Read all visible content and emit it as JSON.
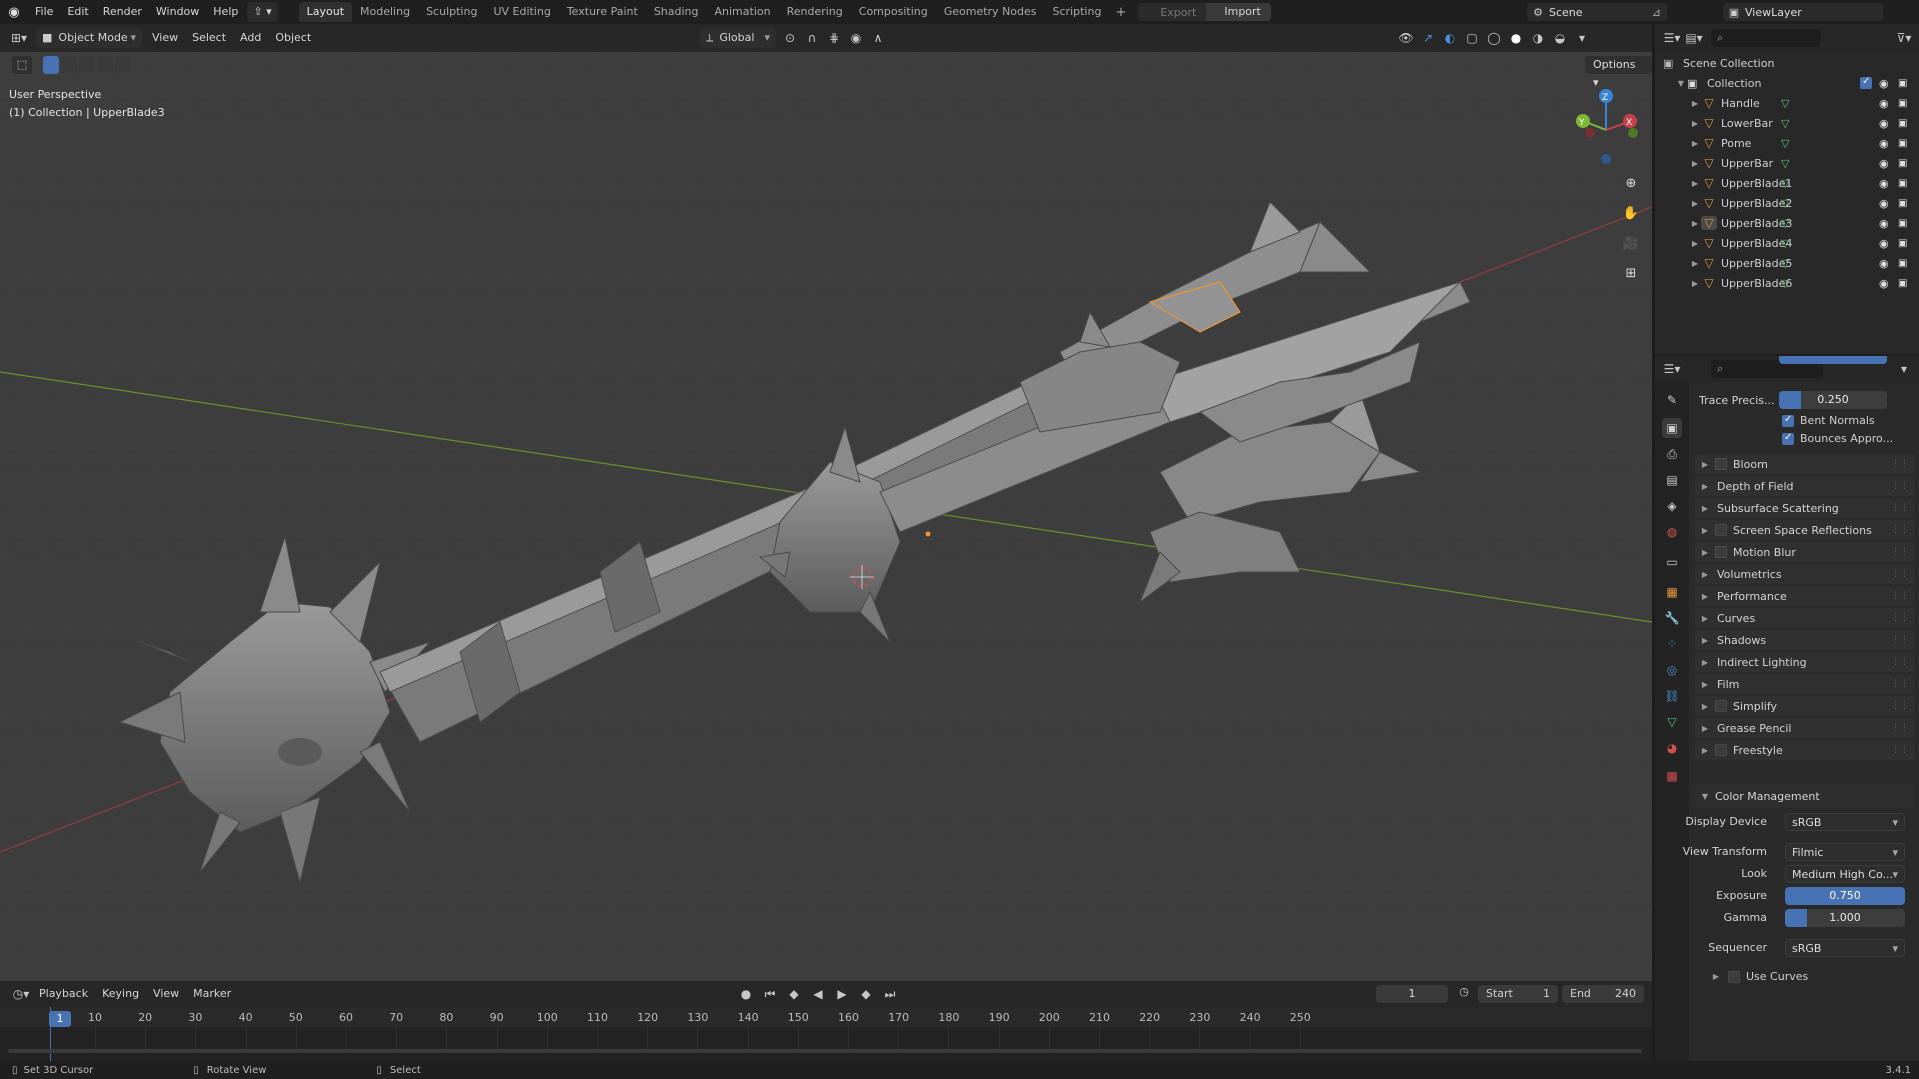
{
  "topbar": {
    "menus": [
      "File",
      "Edit",
      "Render",
      "Window",
      "Help"
    ],
    "workspaces": [
      "Layout",
      "Modeling",
      "Sculpting",
      "UV Editing",
      "Texture Paint",
      "Shading",
      "Animation",
      "Rendering",
      "Compositing",
      "Geometry Nodes",
      "Scripting"
    ],
    "export_label": "Export",
    "import_label": "Import",
    "scene_name": "Scene",
    "view_layer": "ViewLayer"
  },
  "viewport_header": {
    "mode": "Object Mode",
    "menus": [
      "View",
      "Select",
      "Add",
      "Object"
    ],
    "orientation": "Global",
    "options_label": "Options"
  },
  "viewport": {
    "perspective_label": "User Perspective",
    "collection_label": "(1) Collection | UpperBlade3",
    "gizmo_axes": [
      "X",
      "Y",
      "Z"
    ]
  },
  "outliner": {
    "root": "Scene Collection",
    "collection": "Collection",
    "objects": [
      "Handle",
      "LowerBar",
      "Pome",
      "UpperBar",
      "UpperBlade1",
      "UpperBlade2",
      "UpperBlade3",
      "UpperBlade4",
      "UpperBlade5",
      "UpperBlade6"
    ],
    "selected": "UpperBlade3"
  },
  "properties": {
    "trace_precision_label": "Trace Precis...",
    "trace_precision_value": "0.250",
    "bent_normals_label": "Bent Normals",
    "bounces_label": "Bounces Appro...",
    "panels": [
      {
        "label": "Bloom",
        "checkbox": true
      },
      {
        "label": "Depth of Field",
        "checkbox": false
      },
      {
        "label": "Subsurface Scattering",
        "checkbox": false
      },
      {
        "label": "Screen Space Reflections",
        "checkbox": true
      },
      {
        "label": "Motion Blur",
        "checkbox": true
      },
      {
        "label": "Volumetrics",
        "checkbox": false
      },
      {
        "label": "Performance",
        "checkbox": false
      },
      {
        "label": "Curves",
        "checkbox": false
      },
      {
        "label": "Shadows",
        "checkbox": false
      },
      {
        "label": "Indirect Lighting",
        "checkbox": false
      },
      {
        "label": "Film",
        "checkbox": false
      },
      {
        "label": "Simplify",
        "checkbox": true
      },
      {
        "label": "Grease Pencil",
        "checkbox": false
      },
      {
        "label": "Freestyle",
        "checkbox": true
      }
    ],
    "color_management": {
      "title": "Color Management",
      "display_device_label": "Display Device",
      "display_device": "sRGB",
      "view_transform_label": "View Transform",
      "view_transform": "Filmic",
      "look_label": "Look",
      "look": "Medium High Co...",
      "exposure_label": "Exposure",
      "exposure": "0.750",
      "gamma_label": "Gamma",
      "gamma": "1.000",
      "sequencer_label": "Sequencer",
      "sequencer": "sRGB",
      "use_curves_label": "Use Curves"
    }
  },
  "timeline": {
    "menus": [
      "Playback",
      "Keying",
      "View",
      "Marker"
    ],
    "current_frame": "1",
    "start_label": "Start",
    "start": "1",
    "end_label": "End",
    "end": "240",
    "ticks": [
      "10",
      "20",
      "30",
      "40",
      "50",
      "60",
      "70",
      "80",
      "90",
      "100",
      "110",
      "120",
      "130",
      "140",
      "150",
      "160",
      "170",
      "180",
      "190",
      "200",
      "210",
      "220",
      "230",
      "240",
      "250"
    ],
    "playhead_label": "1"
  },
  "statusbar": {
    "hint1": "Set 3D Cursor",
    "hint2": "Rotate View",
    "hint3": "Select",
    "version": "3.4.1"
  },
  "colors": {
    "accent": "#4772b3",
    "x_axis": "#c8404a",
    "y_axis": "#7cb833",
    "z_axis": "#3a84d6",
    "mesh": "#7c7c7c",
    "selected_object": "#e8953a"
  }
}
